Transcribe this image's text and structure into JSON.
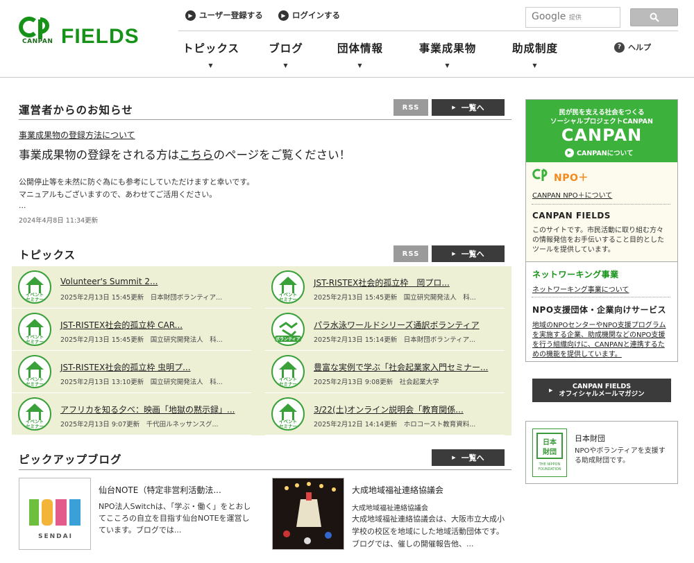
{
  "header": {
    "logo_sub": "CANPAN",
    "logo_main": "FIELDS",
    "register": "ユーザー登録する",
    "login": "ログインする",
    "search_brand": "Google",
    "search_provided": "提供",
    "help": "ヘルプ",
    "nav": [
      "トピックス",
      "ブログ",
      "団体情報",
      "事業成果物",
      "助成制度"
    ]
  },
  "notice": {
    "heading": "運営者からのお知らせ",
    "rss": "RSS",
    "list": "一覧へ",
    "link": "事業成果物の登録方法について",
    "headline_pre": "事業成果物の登録をされる方は",
    "headline_link": "こちら",
    "headline_post": "のページをご覧ください！",
    "body1": "公開停止等を未然に防ぐ為にも参考にしていただけますと幸いです。",
    "body2": "マニュアルもございますので、あわせてご活用ください。",
    "ellipsis": "...",
    "date": "2024年4月8日 11:34更新"
  },
  "topics": {
    "heading": "トピックス",
    "rss": "RSS",
    "list": "一覧へ",
    "items": [
      {
        "title": "Volunteer's Summit 2...",
        "meta": "2025年2月13日 15:45更新　日本財団ボランティア...",
        "icon": "イベントセミナー"
      },
      {
        "title": "JST-RISTEX社会的孤立枠　岡プロ...",
        "meta": "2025年2月13日 15:45更新　国立研究開発法人　科...",
        "icon": "イベントセミナー"
      },
      {
        "title": "JST-RISTEX社会的孤立枠 CAR...",
        "meta": "2025年2月13日 15:45更新　国立研究開発法人　科...",
        "icon": "イベントセミナー"
      },
      {
        "title": "パラ水泳ワールドシリーズ通訳ボランティア",
        "meta": "2025年2月13日 15:14更新　日本財団ボランティア...",
        "icon": "ボランティア"
      },
      {
        "title": "JST-RISTEX社会的孤立枠 虫明プ...",
        "meta": "2025年2月13日 13:10更新　国立研究開発法人　科...",
        "icon": "イベントセミナー"
      },
      {
        "title": "豊富な実例で学ぶ「社会起業家入門セミナー...",
        "meta": "2025年2月13日 9:08更新　社会起業大学",
        "icon": "イベントセミナー"
      },
      {
        "title": "アフリカを知る夕べ：映画「地獄の黙示録」...",
        "meta": "2025年2月13日 9:07更新　千代田ルネッサンスグ...",
        "icon": "イベントセミナー"
      },
      {
        "title": "3/22(土)オンライン説明会「教育関係...",
        "meta": "2025年2月12日 14:14更新　ホロコースト教育資料...",
        "icon": "イベントセミナー"
      }
    ]
  },
  "blog": {
    "heading": "ピックアップブログ",
    "list": "一覧へ",
    "items": [
      {
        "title": "仙台NOTE（特定非営利活動法...",
        "sub": "",
        "d1": "NPO法人Switchは、「学ぶ・働く」をとおし",
        "d2": "てこころの自立を目指す仙台NOTEを運営し",
        "d3": "ています。ブログでは...",
        "img_text": "NOTE",
        "img_sub": "SENDAI"
      },
      {
        "title": "大成地域福祉連絡協議会",
        "sub": "大成地域福祉連絡協議会",
        "d1": "大成地域福祉連絡協議会は、大阪市立大成小",
        "d2": "学校の校区を地域にした地域活動団体です。",
        "d3": "ブログでは、催しの開催報告他、..."
      }
    ]
  },
  "sidebar": {
    "tag1": "民が民を支える社会をつくる",
    "tag2": "ソーシャルプロジェクトCANPAN",
    "canpan_logo": "CANPAN",
    "about": "CANPANについて",
    "npo_plus": "NPO＋",
    "npo_plus_link": "CANPAN NPO＋について",
    "fields_title": "CANPAN FIELDS",
    "fields_d1": "このサイトです。市民活動に取り組む方々",
    "fields_d2": "の情報発信をお手伝いすること目的とした",
    "fields_d3": "ツールを提供しています。",
    "network_title": "ネットワーキング事業",
    "network_link": "ネットワーキング事業について",
    "support_title": "NPO支援団体・企業向けサービス",
    "support_l1": "地域のNPOセンターやNPO支援プログラム",
    "support_l2": "を実施する企業、助成機関などのNPO支援",
    "support_l3": "を行う組織向けに、CANPANと連携するた",
    "support_l4": "めの機能を提供しています。",
    "mail1": "CANPAN FIELDS",
    "mail2": "オフィシャルメールマガジン",
    "nf_name": "日本財団",
    "nf_d1": "NPOやボランティアを支援す",
    "nf_d2": "る助成財団です。",
    "nf_logo_en": "THE NIPPON FOUNDATION"
  },
  "colors": {
    "brand_green": "#169218",
    "sidebar_green": "#3cb13c",
    "topic_bg": "#eef0d6",
    "dark_button": "#3b3b3b"
  }
}
